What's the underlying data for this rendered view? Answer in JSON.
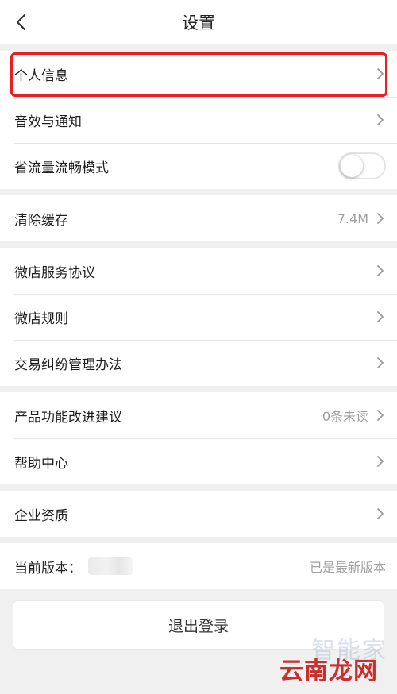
{
  "header": {
    "title": "设置",
    "back_icon": "chevron-left-icon"
  },
  "groups": [
    {
      "items": [
        {
          "label": "个人信息"
        },
        {
          "label": "音效与通知"
        },
        {
          "label": "省流量流畅模式",
          "toggle_on": false
        }
      ]
    },
    {
      "items": [
        {
          "label": "清除缓存",
          "value": "7.4M"
        }
      ]
    },
    {
      "items": [
        {
          "label": "微店服务协议"
        },
        {
          "label": "微店规则"
        },
        {
          "label": "交易纠纷管理办法"
        }
      ]
    },
    {
      "items": [
        {
          "label": "产品功能改进建议",
          "value": "0条未读"
        },
        {
          "label": "帮助中心"
        }
      ]
    },
    {
      "items": [
        {
          "label": "企业资质"
        }
      ]
    },
    {
      "items": [
        {
          "label": "当前版本：",
          "value": "已是最新版本"
        }
      ]
    }
  ],
  "logout_label": "退出登录",
  "watermark": {
    "faint": "智能家",
    "brand": "云南龙网"
  },
  "colors": {
    "highlight": "#ee1d23",
    "value_text": "#a0a0a0",
    "background": "#f0f0f0"
  }
}
